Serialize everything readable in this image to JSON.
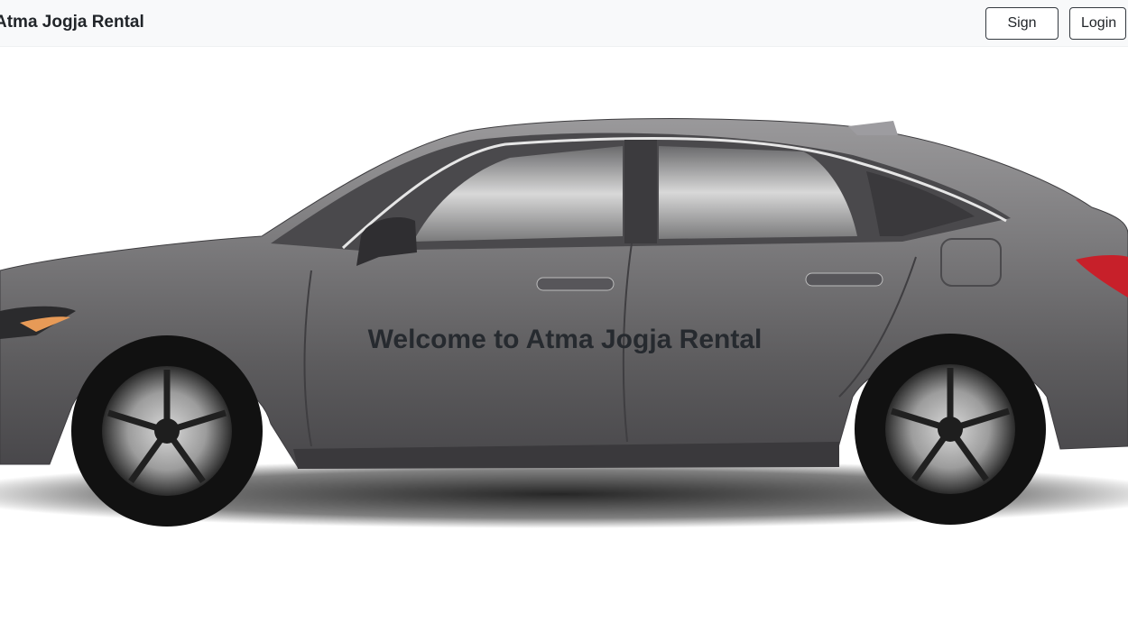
{
  "navbar": {
    "brand": "Atma Jogja Rental",
    "signup_label": "Sign Up",
    "login_label": "Login"
  },
  "hero": {
    "welcome_text": "Welcome to Atma Jogja Rental",
    "image_subject": "gray-sedan-side-view",
    "car_color": "#6b6a6c"
  }
}
